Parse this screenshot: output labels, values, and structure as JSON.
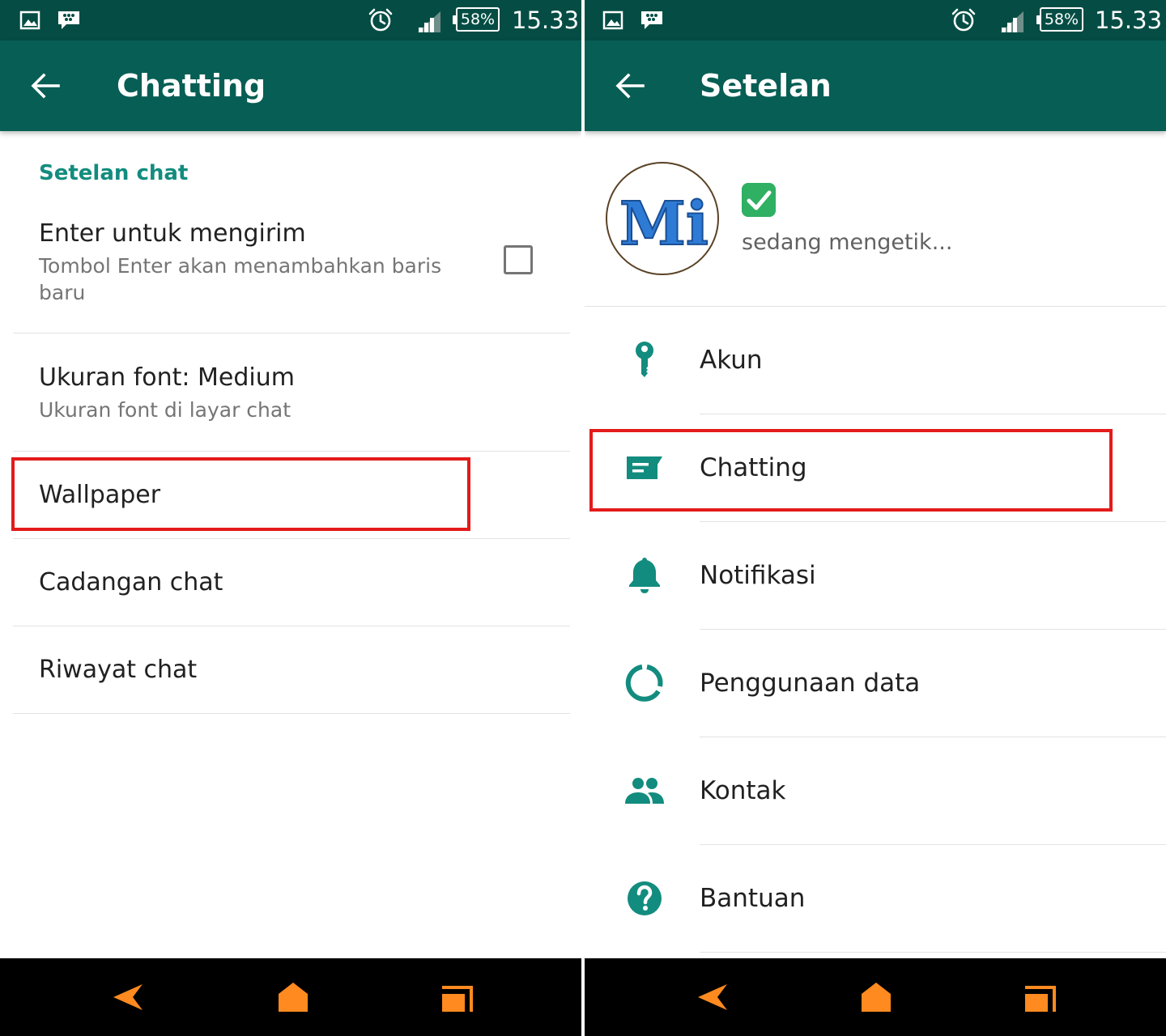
{
  "status_bar": {
    "battery": "58%",
    "time": "15.33"
  },
  "left": {
    "title": "Chatting",
    "section_header": "Setelan chat",
    "enter_to_send": {
      "title": "Enter untuk mengirim",
      "subtitle": "Tombol Enter akan menambahkan baris baru",
      "checked": false
    },
    "font_size": {
      "title": "Ukuran font: Medium",
      "subtitle": "Ukuran font di layar chat"
    },
    "wallpaper": {
      "title": "Wallpaper"
    },
    "backup": {
      "title": "Cadangan chat"
    },
    "history": {
      "title": "Riwayat chat"
    }
  },
  "right": {
    "title": "Setelan",
    "profile": {
      "avatar_text": "Mi",
      "status": "sedang mengetik..."
    },
    "items": [
      {
        "label": "Akun",
        "icon": "key-icon"
      },
      {
        "label": "Chatting",
        "icon": "chat-icon"
      },
      {
        "label": "Notifikasi",
        "icon": "bell-icon"
      },
      {
        "label": "Penggunaan data",
        "icon": "data-usage-icon"
      },
      {
        "label": "Kontak",
        "icon": "contacts-icon"
      },
      {
        "label": "Bantuan",
        "icon": "help-icon"
      }
    ]
  },
  "colors": {
    "status_bar": "#054d44",
    "toolbar": "#075e54",
    "accent": "#128c7e",
    "highlight": "#e31b1b",
    "nav_icons": "#ff8a1f"
  }
}
